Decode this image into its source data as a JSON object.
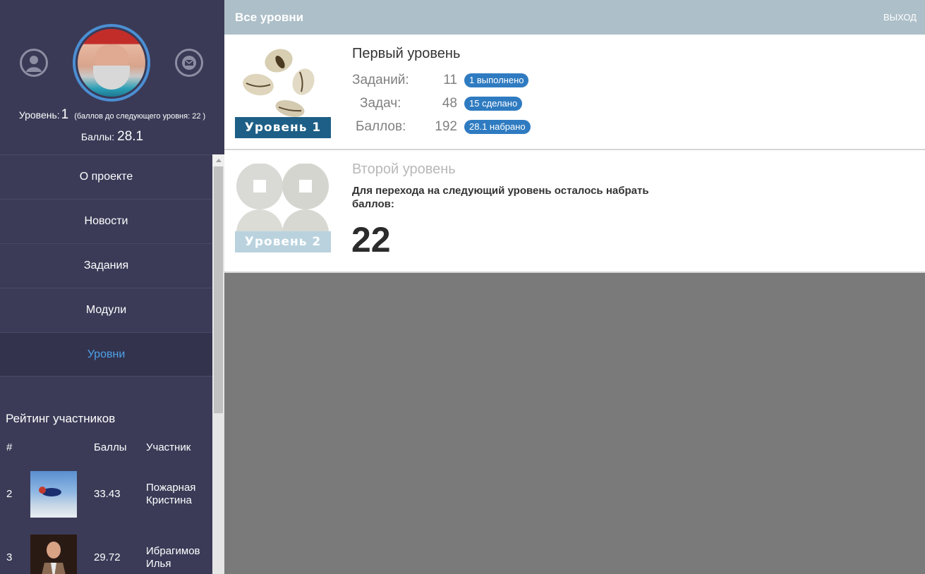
{
  "profile": {
    "level_label": "Уровень:",
    "level_value": "1",
    "next_level_note": "(баллов до следующего уровня: 22 )",
    "points_label": "Баллы:",
    "points_value": "28.1"
  },
  "nav": [
    {
      "label": "О проекте"
    },
    {
      "label": "Новости"
    },
    {
      "label": "Задания"
    },
    {
      "label": "Модули"
    },
    {
      "label": "Уровни",
      "active": true
    }
  ],
  "rating": {
    "title": "Рейтинг участников",
    "columns": [
      "#",
      "Баллы",
      "Участник"
    ],
    "rows": [
      {
        "rank": "2",
        "points": "33.43",
        "name_line1": "Пожарная",
        "name_line2": "Кристина"
      },
      {
        "rank": "3",
        "points": "29.72",
        "name_line1": "Ибрагимов",
        "name_line2": "Илья"
      }
    ]
  },
  "topbar": {
    "title": "Все уровни",
    "logout": "ВЫХОД"
  },
  "levels": [
    {
      "title": "Первый уровень",
      "badge": "Уровень 1",
      "stats": [
        {
          "label": "Заданий:",
          "value": "11",
          "pill": "1 выполнено"
        },
        {
          "label": "Задач:",
          "value": "48",
          "pill": "15 сделано"
        },
        {
          "label": "Баллов:",
          "value": "192",
          "pill": "28.1 набрано"
        }
      ]
    },
    {
      "title": "Второй уровень",
      "badge": "Уровень 2",
      "requirement": "Для перехода на следующий уровень осталось набрать баллов:",
      "remaining": "22"
    }
  ],
  "colors": {
    "sidebar": "#3b3b58",
    "accent": "#4da2e8",
    "pill": "#2f7bc1",
    "topbar": "#adbfc8",
    "badge1": "#1d5f86",
    "badge2": "#b9d2de"
  },
  "icons": [
    "user-icon",
    "mail-icon"
  ]
}
